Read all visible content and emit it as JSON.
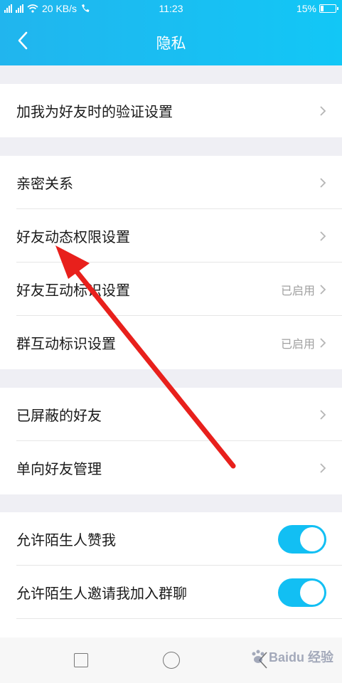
{
  "status_bar": {
    "network_speed": "20 KB/s",
    "time": "11:23",
    "battery": "15%"
  },
  "header": {
    "title": "隐私",
    "back_icon": "chevron-left-icon"
  },
  "groups": [
    {
      "items": [
        {
          "label": "加我为好友时的验证设置"
        }
      ]
    },
    {
      "items": [
        {
          "label": "亲密关系"
        },
        {
          "label": "好友动态权限设置"
        },
        {
          "label": "好友互动标识设置",
          "status": "已启用"
        },
        {
          "label": "群互动标识设置",
          "status": "已启用"
        }
      ]
    },
    {
      "items": [
        {
          "label": "已屏蔽的好友"
        },
        {
          "label": "单向好友管理"
        }
      ]
    },
    {
      "items": [
        {
          "label": "允许陌生人赞我",
          "toggle": true
        },
        {
          "label": "允许陌生人邀请我加入群聊",
          "toggle": true
        }
      ]
    }
  ],
  "nav_bar": {
    "watermark": "Baidu 经验"
  },
  "colors": {
    "accent": "#12bff3",
    "annotation_arrow": "#e8201c"
  }
}
